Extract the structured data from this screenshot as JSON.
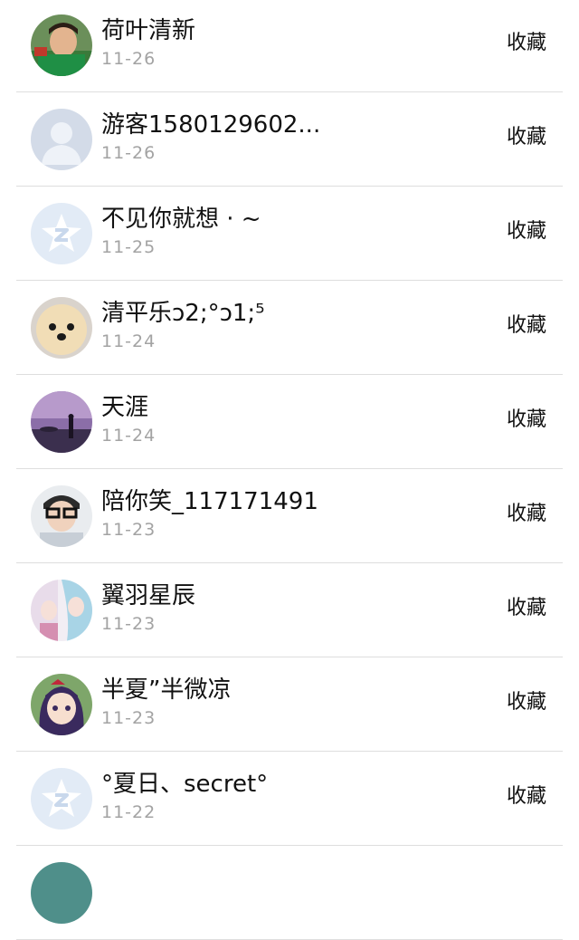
{
  "items": [
    {
      "name": "荷叶清新",
      "date": "11-26",
      "action": "收藏",
      "avatar": "avatar-photo-boy"
    },
    {
      "name": "游客1580129602...",
      "date": "11-26",
      "action": "收藏",
      "avatar": "avatar-default-person"
    },
    {
      "name": "不见你就想 · ~",
      "date": "11-25",
      "action": "收藏",
      "avatar": "avatar-default-star"
    },
    {
      "name": "清平乐ↄ2;°ↄ1;⁵",
      "date": "11-24",
      "action": "收藏",
      "avatar": "avatar-photo-dog"
    },
    {
      "name": "天涯",
      "date": "11-24",
      "action": "收藏",
      "avatar": "avatar-photo-sunset"
    },
    {
      "name": "陪你笑_117171491",
      "date": "11-23",
      "action": "收藏",
      "avatar": "avatar-photo-glasses"
    },
    {
      "name": "翼羽星辰",
      "date": "11-23",
      "action": "收藏",
      "avatar": "avatar-anime-girls"
    },
    {
      "name": "半夏”半微凉",
      "date": "11-23",
      "action": "收藏",
      "avatar": "avatar-anime-girl"
    },
    {
      "name": "°夏日、secret°",
      "date": "11-22",
      "action": "收藏",
      "avatar": "avatar-default-star"
    },
    {
      "name": "",
      "date": "",
      "action": "",
      "avatar": "avatar-photo-partial"
    }
  ]
}
